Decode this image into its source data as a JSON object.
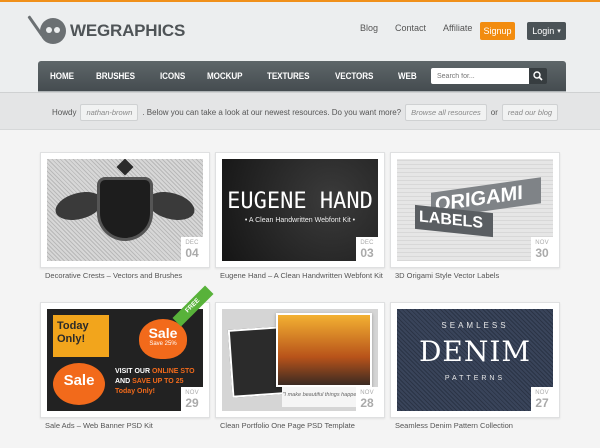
{
  "brand": {
    "name": "WEGRAPHICS",
    "accent": "#f0901a"
  },
  "toplinks": [
    "Blog",
    "Contact",
    "Affiliate"
  ],
  "buttons": {
    "signup": "Signup",
    "login": "Login",
    "login_caret": "▾"
  },
  "nav": {
    "items": [
      "HOME",
      "BRUSHES",
      "ICONS",
      "MOCKUP",
      "TEXTURES",
      "VECTORS",
      "WEB"
    ],
    "search_placeholder": "Search for..."
  },
  "howdy": {
    "prefix": "Howdy",
    "username": "nathan-brown",
    "message": ". Below you can take a look at our newest resources. Do you want more?",
    "link1": "Browse all resources",
    "or": "or",
    "link2": "read our blog"
  },
  "cards": [
    {
      "title": "Decorative Crests – Vectors and Brushes",
      "month": "DEC",
      "day": "04"
    },
    {
      "title": "Eugene Hand – A Clean Handwritten Webfont Kit",
      "month": "DEC",
      "day": "03",
      "art_title": "EUGENE HAND",
      "art_sub": "• A Clean Handwritten Webfont Kit •"
    },
    {
      "title": "3D Origami Style Vector Labels",
      "month": "NOV",
      "day": "30",
      "art_line1": "ORIGAMI",
      "art_line2": "LABELS"
    },
    {
      "title": "Sale Ads – Web Banner PSD Kit",
      "month": "NOV",
      "day": "29",
      "art_a": "Today Only!",
      "art_b": "Sale",
      "art_b_sub": "Save 25%",
      "art_c": "Sale",
      "art_d1": "VISIT OUR",
      "art_d2": "ONLINE STO",
      "art_d3": "AND",
      "art_d4": "SAVE UP TO 25",
      "art_d5": "Today Only!"
    },
    {
      "title": "Clean Portfolio One Page PSD Template",
      "month": "NOV",
      "day": "28",
      "ribbon": "FREE",
      "art_quote": "\"I make beautiful things happen\""
    },
    {
      "title": "Seamless Denim Pattern Collection",
      "month": "NOV",
      "day": "27",
      "art_top": "SEAMLESS",
      "art_main": "DENIM",
      "art_bottom": "PATTERNS"
    }
  ]
}
